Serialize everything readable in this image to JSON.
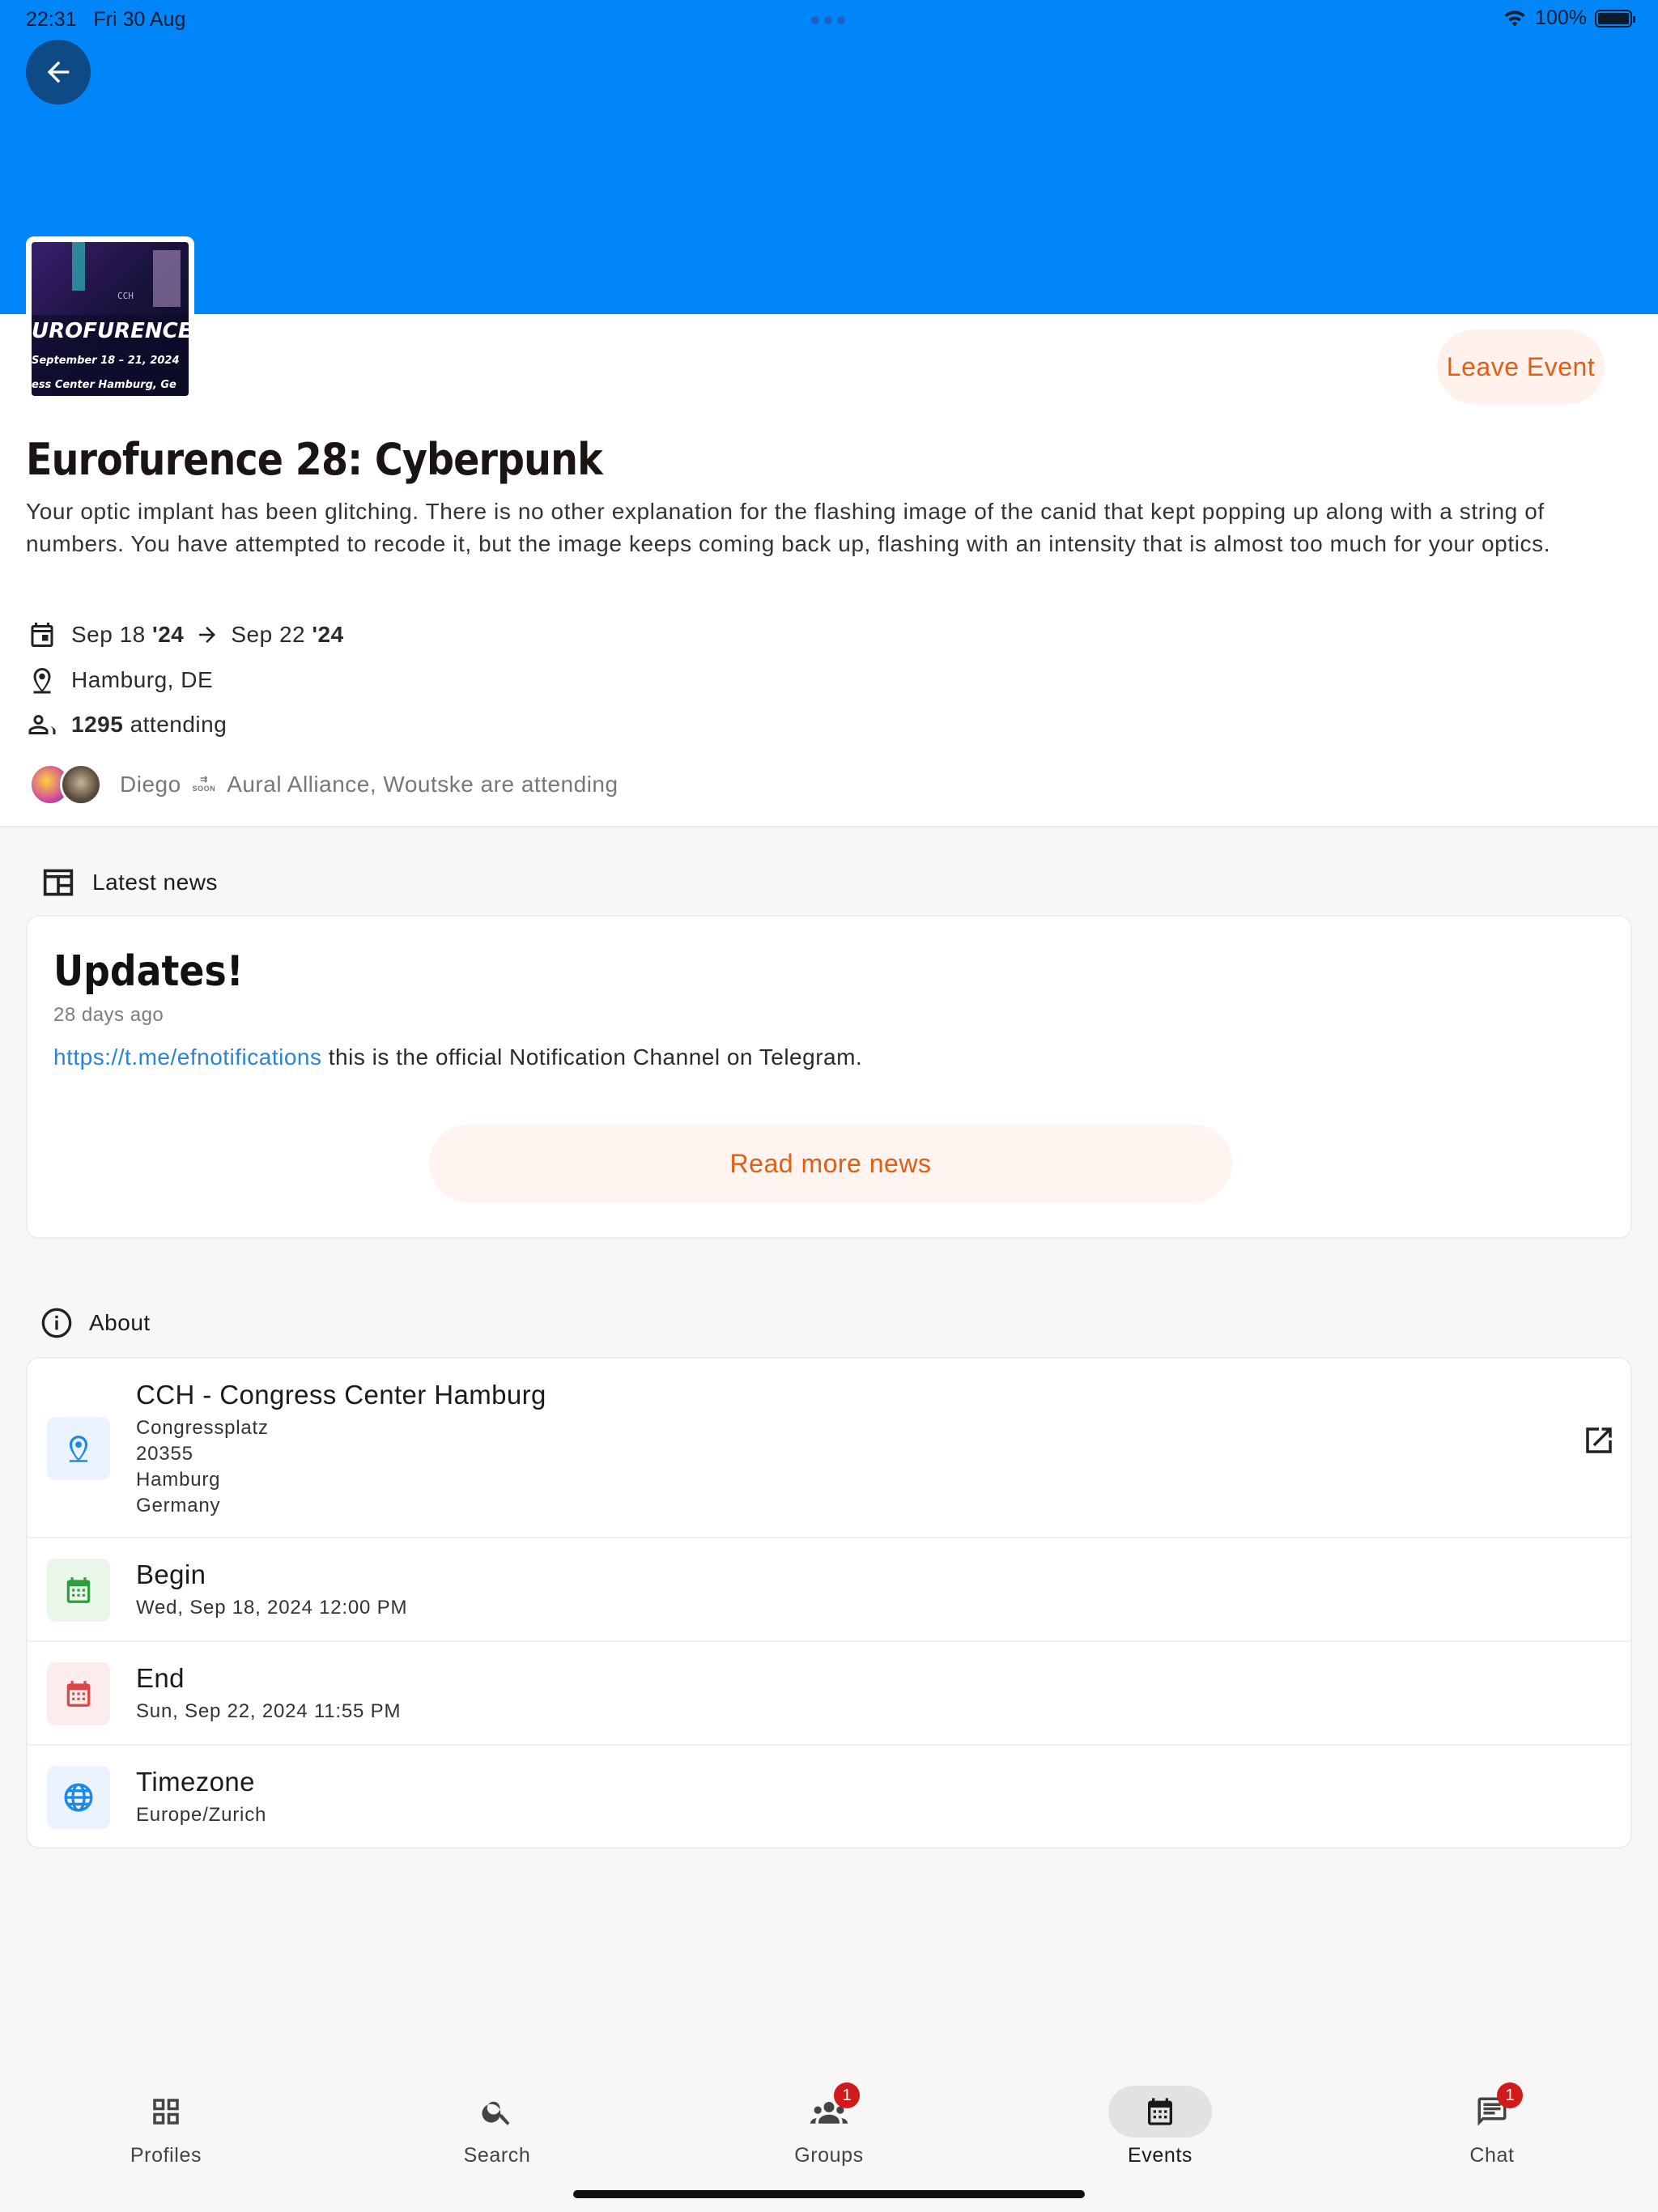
{
  "status_bar": {
    "time": "22:31",
    "date": "Fri 30 Aug",
    "battery": "100%"
  },
  "event": {
    "title": "Eurofurence 28: Cyberpunk",
    "description": "Your optic implant has been glitching. There is no other explanation for the flashing image of the canid that kept popping up along with a string of numbers. You have attempted to recode it, but the image keeps coming back up, flashing with an intensity that is almost too much for your optics.",
    "leave_label": "Leave Event",
    "date_start_day": "Sep 18",
    "date_start_year": "'24",
    "date_end_day": "Sep 22",
    "date_end_year": "'24",
    "location": "Hamburg, DE",
    "attending_count": "1295",
    "attending_label": "attending",
    "friends_first": "Diego",
    "friends_rest": "Aural Alliance, Woutske are attending",
    "soon_badge": "SOON",
    "thumbnail": {
      "title": "UROFURENCE",
      "dates": "September 18 – 21, 2024",
      "venue": "ess Center Hamburg, Ge",
      "logo": "CCH"
    }
  },
  "news": {
    "section_label": "Latest news",
    "title": "Updates!",
    "age": "28 days ago",
    "link": "https://t.me/efnotifications",
    "body": " this is the official Notification Channel on Telegram.",
    "read_more_label": "Read more news"
  },
  "about": {
    "section_label": "About",
    "venue_name": "CCH - Congress Center Hamburg",
    "address": [
      "Congressplatz",
      "20355",
      "Hamburg",
      "Germany"
    ],
    "begin_label": "Begin",
    "begin_value": "Wed, Sep 18, 2024 12:00 PM",
    "end_label": "End",
    "end_value": "Sun, Sep 22, 2024 11:55 PM",
    "timezone_label": "Timezone",
    "timezone_value": "Europe/Zurich"
  },
  "nav": {
    "items": [
      {
        "label": "Profiles",
        "icon": "grid-icon"
      },
      {
        "label": "Search",
        "icon": "search-icon"
      },
      {
        "label": "Groups",
        "icon": "groups-icon",
        "badge": "1"
      },
      {
        "label": "Events",
        "icon": "calendar-icon",
        "active": true
      },
      {
        "label": "Chat",
        "icon": "chat-icon",
        "badge": "1"
      }
    ]
  },
  "colors": {
    "banner": "#0086f8",
    "accent": "#e35d12",
    "link": "#2a83d6",
    "badge": "#d11a1a"
  }
}
